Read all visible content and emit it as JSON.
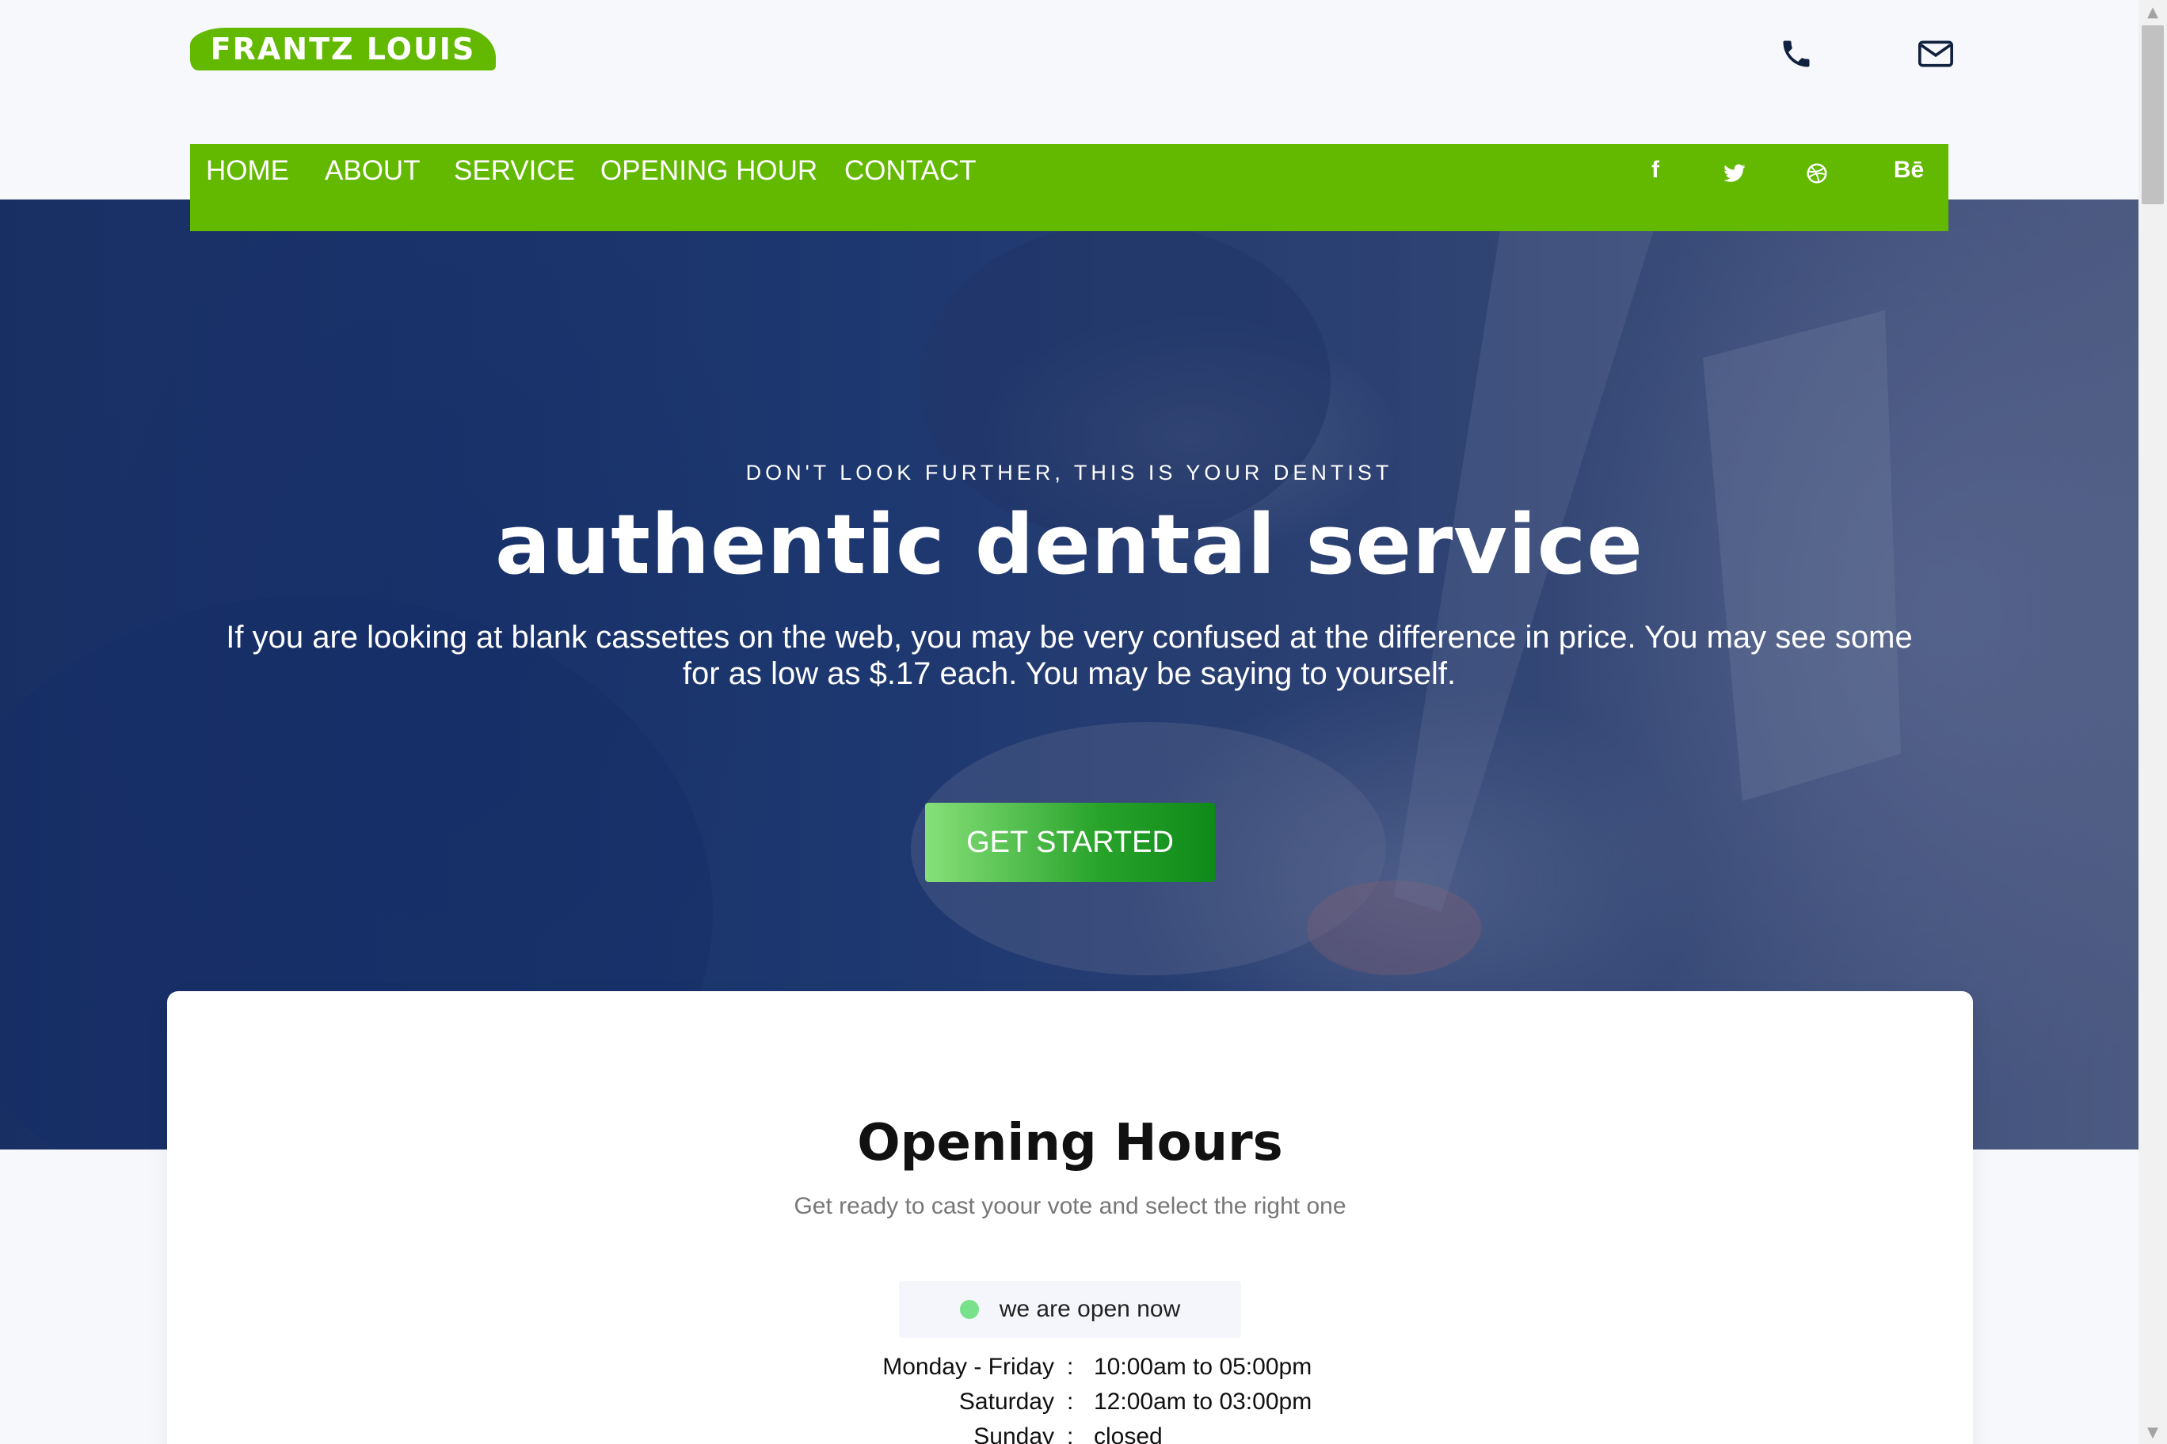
{
  "brand": {
    "logo_text": "FRANTZ LOUIS",
    "accent_color": "#62b900"
  },
  "header_icons": [
    {
      "name": "phone-icon"
    },
    {
      "name": "envelope-icon"
    }
  ],
  "nav": {
    "items": [
      "HOME",
      "ABOUT",
      "SERVICE",
      "OPENING HOUR",
      "CONTACT"
    ],
    "social": [
      "f",
      "Bē"
    ]
  },
  "hero": {
    "subtitle": "DON'T LOOK FURTHER, THIS IS YOUR DENTIST",
    "title": "authentic dental service",
    "lead": "If you are looking at blank cassettes on the web, you may be very confused at the difference in price. You may see some for as low as $.17 each. You may be saying to yourself.",
    "cta": "GET STARTED"
  },
  "hours": {
    "title": "Opening Hours",
    "subtitle": "Get ready to cast yoour vote and select the right one",
    "status": "we are open now",
    "status_color": "#78e28a",
    "separator": ":",
    "rows": [
      {
        "day": "Monday - Friday",
        "time": "10:00am to 05:00pm"
      },
      {
        "day": "Saturday",
        "time": "12:00am to 03:00pm"
      },
      {
        "day": "Sunday",
        "time": "closed"
      }
    ]
  },
  "scrollbar": {
    "up": "▲",
    "down": "▼"
  }
}
